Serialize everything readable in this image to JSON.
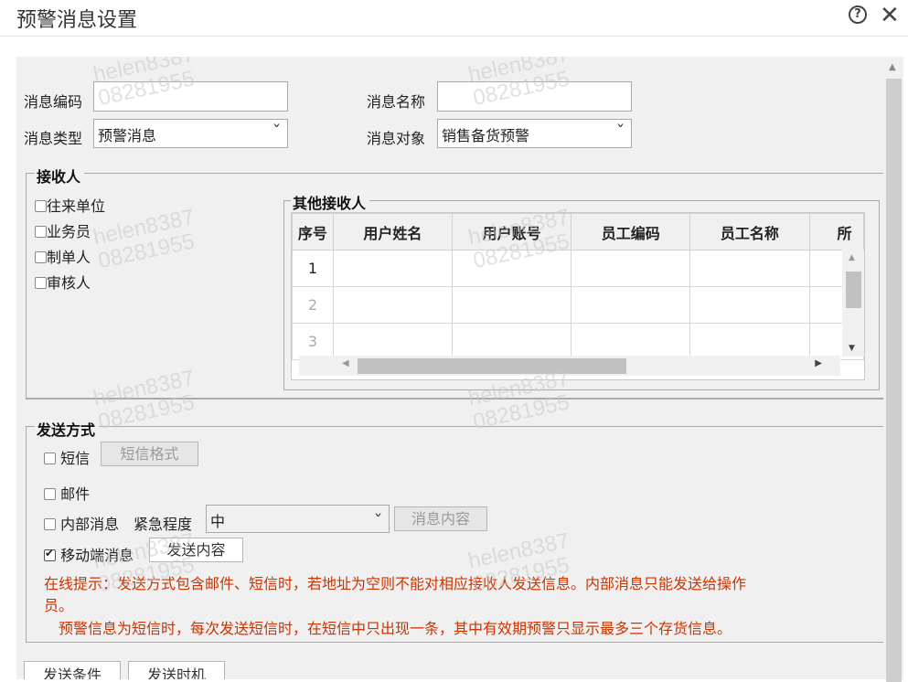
{
  "dialog": {
    "title": "预警消息设置"
  },
  "form": {
    "msg_code_label": "消息编码",
    "msg_code_value": "",
    "msg_name_label": "消息名称",
    "msg_name_value": "",
    "msg_type_label": "消息类型",
    "msg_type_value": "预警消息",
    "msg_target_label": "消息对象",
    "msg_target_value": "销售备货预警"
  },
  "receivers": {
    "legend": "接收人",
    "options": [
      {
        "label": "往来单位",
        "checked": false
      },
      {
        "label": "业务员",
        "checked": false
      },
      {
        "label": "制单人",
        "checked": false
      },
      {
        "label": "审核人",
        "checked": false
      }
    ]
  },
  "other_receivers": {
    "legend": "其他接收人",
    "columns": [
      "序号",
      "用户姓名",
      "用户账号",
      "员工编码",
      "员工名称",
      "所"
    ],
    "rows": [
      "1",
      "2",
      "3"
    ]
  },
  "send": {
    "legend": "发送方式",
    "sms_label": "短信",
    "sms_format_button": "短信格式",
    "email_label": "邮件",
    "internal_label": "内部消息",
    "urgency_label": "紧急程度",
    "urgency_value": "中",
    "internal_content_button": "消息内容",
    "mobile_label": "移动端消息",
    "mobile_content_button": "发送内容",
    "hint_line1": "在线提示：发送方式包含邮件、短信时，若地址为空则不能对相应接收人发送信息。内部消息只能发送给操作",
    "hint_line2": "员。",
    "hint_line3": "预警信息为短信时，每次发送短信时，在短信中只出现一条，其中有效期预警只显示最多三个存货信息。"
  },
  "bottom": {
    "send_condition_button": "发送条件",
    "send_time_button": "发送时机"
  },
  "watermark": {
    "line1": "helen8387",
    "line2": "08281955"
  }
}
